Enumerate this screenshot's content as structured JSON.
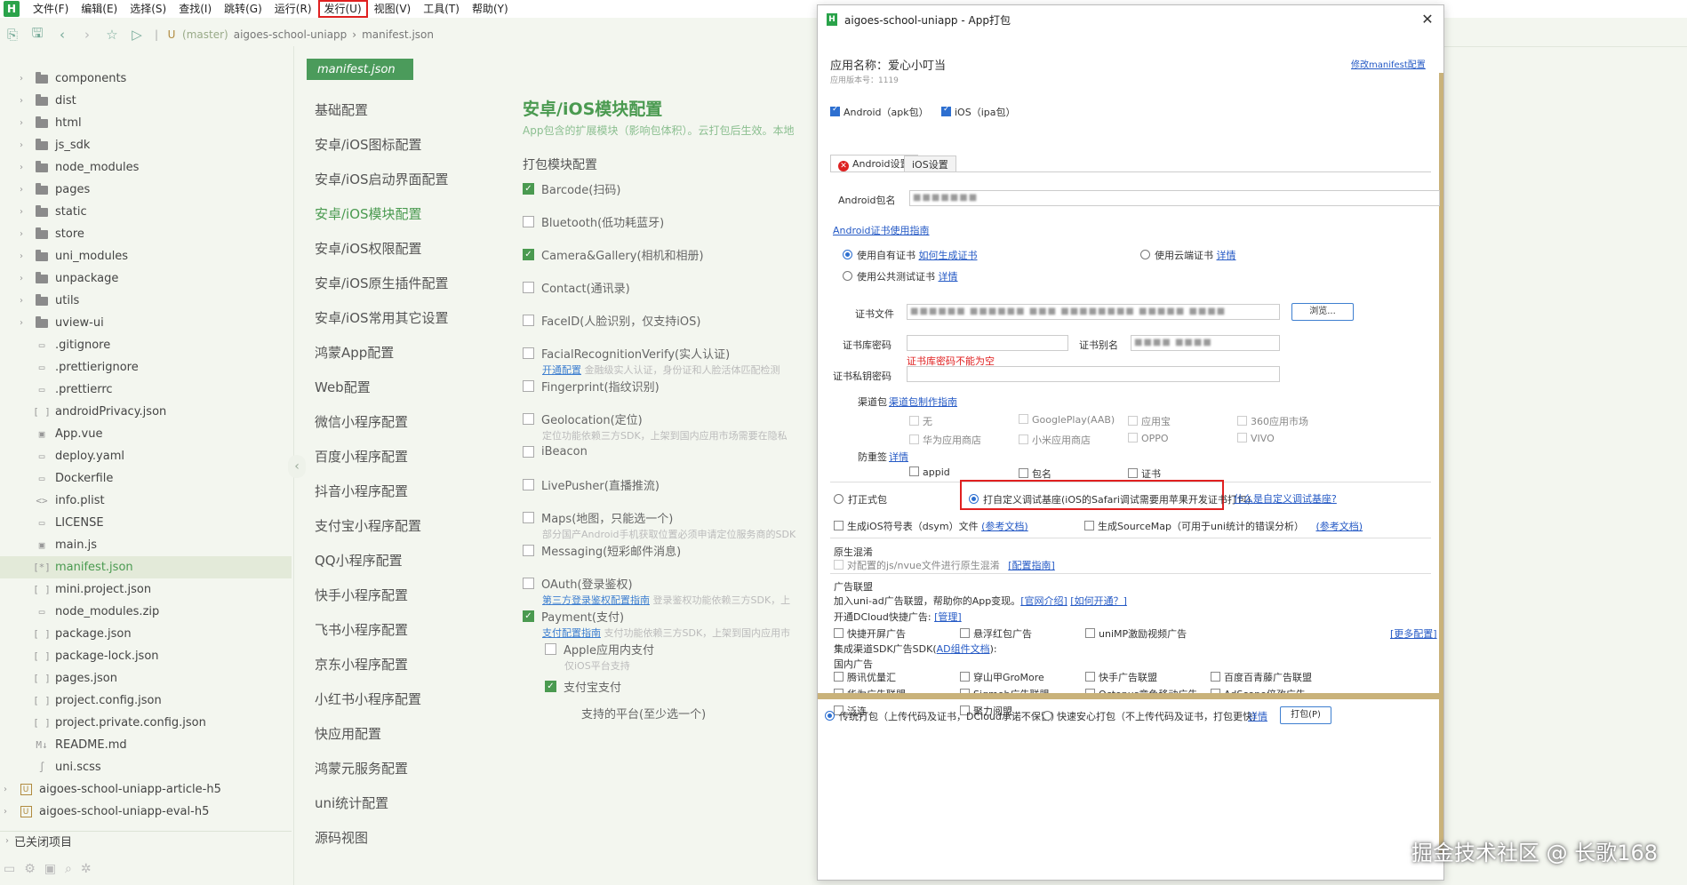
{
  "menubar": {
    "logo": "H",
    "items": [
      "文件(F)",
      "编辑(E)",
      "选择(S)",
      "查找(I)",
      "跳转(G)",
      "运行(R)",
      "发行(U)",
      "视图(V)",
      "工具(T)",
      "帮助(Y)"
    ],
    "highlighted_index": 6
  },
  "toolbar": {
    "branch": "(master)",
    "project": "aigoes-school-uniapp",
    "file": "manifest.json"
  },
  "filetree": {
    "items": [
      {
        "label": "components",
        "type": "folder"
      },
      {
        "label": "dist",
        "type": "folder"
      },
      {
        "label": "html",
        "type": "folder"
      },
      {
        "label": "js_sdk",
        "type": "folder"
      },
      {
        "label": "node_modules",
        "type": "folder"
      },
      {
        "label": "pages",
        "type": "folder"
      },
      {
        "label": "static",
        "type": "folder"
      },
      {
        "label": "store",
        "type": "folder"
      },
      {
        "label": "uni_modules",
        "type": "folder"
      },
      {
        "label": "unpackage",
        "type": "folder"
      },
      {
        "label": "utils",
        "type": "folder"
      },
      {
        "label": "uview-ui",
        "type": "folder"
      },
      {
        "label": ".gitignore",
        "type": "file",
        "glyph": "▭"
      },
      {
        "label": ".prettierignore",
        "type": "file",
        "glyph": "▭"
      },
      {
        "label": ".prettierrc",
        "type": "file",
        "glyph": "▭"
      },
      {
        "label": "androidPrivacy.json",
        "type": "file",
        "glyph": "[ ]"
      },
      {
        "label": "App.vue",
        "type": "file",
        "glyph": "▣"
      },
      {
        "label": "deploy.yaml",
        "type": "file",
        "glyph": "▭"
      },
      {
        "label": "Dockerfile",
        "type": "file",
        "glyph": "▭"
      },
      {
        "label": "info.plist",
        "type": "file",
        "glyph": "<>"
      },
      {
        "label": "LICENSE",
        "type": "file",
        "glyph": "▭"
      },
      {
        "label": "main.js",
        "type": "file",
        "glyph": "▣"
      },
      {
        "label": "manifest.json",
        "type": "file",
        "glyph": "[*]",
        "selected": true
      },
      {
        "label": "mini.project.json",
        "type": "file",
        "glyph": "[ ]"
      },
      {
        "label": "node_modules.zip",
        "type": "file",
        "glyph": "▭"
      },
      {
        "label": "package.json",
        "type": "file",
        "glyph": "[ ]"
      },
      {
        "label": "package-lock.json",
        "type": "file",
        "glyph": "[ ]"
      },
      {
        "label": "pages.json",
        "type": "file",
        "glyph": "[ ]"
      },
      {
        "label": "project.config.json",
        "type": "file",
        "glyph": "[ ]"
      },
      {
        "label": "project.private.config.json",
        "type": "file",
        "glyph": "[ ]"
      },
      {
        "label": "README.md",
        "type": "file",
        "glyph": "M↓"
      },
      {
        "label": "uni.scss",
        "type": "file",
        "glyph": "∫"
      },
      {
        "label": "aigoes-school-uniapp-article-h5",
        "type": "root"
      },
      {
        "label": "aigoes-school-uniapp-eval-h5",
        "type": "root"
      }
    ],
    "closed_projects": "已关闭项目"
  },
  "editor": {
    "tab": "manifest.json",
    "nav": [
      "基础配置",
      "安卓/iOS图标配置",
      "安卓/iOS启动界面配置",
      "安卓/iOS模块配置",
      "安卓/iOS权限配置",
      "安卓/iOS原生插件配置",
      "安卓/iOS常用其它设置",
      "鸿蒙App配置",
      "Web配置",
      "微信小程序配置",
      "百度小程序配置",
      "抖音小程序配置",
      "支付宝小程序配置",
      "QQ小程序配置",
      "快手小程序配置",
      "飞书小程序配置",
      "京东小程序配置",
      "小红书小程序配置",
      "快应用配置",
      "鸿蒙元服务配置",
      "uni统计配置",
      "源码视图"
    ],
    "nav_active_index": 3,
    "module_title": "安卓/iOS模块配置",
    "module_subtitle": "App包含的扩展模块（影响包体积）。云打包后生效。本地",
    "section_title": "打包模块配置",
    "modules": [
      {
        "label": "Barcode(扫码)",
        "checked": true,
        "desc": ""
      },
      {
        "label": "Bluetooth(低功耗蓝牙)",
        "checked": false,
        "desc": ""
      },
      {
        "label": "Camera&Gallery(相机和相册)",
        "checked": true,
        "desc": ""
      },
      {
        "label": "Contact(通讯录)",
        "checked": false,
        "desc": ""
      },
      {
        "label": "FaceID(人脸识别，仅支持iOS)",
        "checked": false,
        "desc": ""
      },
      {
        "label": "FacialRecognitionVerify(实人认证)",
        "checked": false,
        "desc": "金融级实人认证，身份证和人脸活体匹配检测",
        "link": "开通配置"
      },
      {
        "label": "Fingerprint(指纹识别)",
        "checked": false,
        "desc": ""
      },
      {
        "label": "Geolocation(定位)",
        "checked": false,
        "desc": "定位功能依赖三方SDK，上架到国内应用市场需要在隐私"
      },
      {
        "label": "iBeacon",
        "checked": false,
        "desc": ""
      },
      {
        "label": "LivePusher(直播推流)",
        "checked": false,
        "desc": ""
      },
      {
        "label": "Maps(地图，只能选一个)",
        "checked": false,
        "desc": "部分国产Android手机获取位置必须申请定位服务商的SDK"
      },
      {
        "label": "Messaging(短彩邮件消息)",
        "checked": false,
        "desc": ""
      },
      {
        "label": "OAuth(登录鉴权)",
        "checked": false,
        "desc": "登录鉴权功能依赖三方SDK，上",
        "link": "第三方登录鉴权配置指南"
      },
      {
        "label": "Payment(支付)",
        "checked": true,
        "desc": "支付功能依赖三方SDK，上架到国内应用市",
        "link": "支付配置指南"
      }
    ],
    "sub_modules": [
      {
        "label": "Apple应用内支付",
        "checked": false,
        "desc": "仅iOS平台支持"
      },
      {
        "label": "支付宝支付",
        "checked": true,
        "desc": ""
      }
    ],
    "platforms_label": "支持的平台(至少选一个)"
  },
  "dialog": {
    "title": "aigoes-school-uniapp - App打包",
    "app_name_label": "应用名称：爱心小叮当",
    "app_version_label": "应用版本号：1119",
    "modify_manifest_link": "修改manifest配置",
    "targets": [
      {
        "label": "Android（apk包）",
        "checked": true
      },
      {
        "label": "iOS（ipa包）",
        "checked": true
      }
    ],
    "tabs": [
      "Android设置",
      "iOS设置"
    ],
    "package_name_label": "Android包名",
    "package_name_value": "■■■■■■■",
    "cert_guide_link": "Android证书使用指南",
    "cert_options": [
      {
        "label": "使用自有证书",
        "link": "如何生成证书",
        "checked": true
      },
      {
        "label": "使用云端证书",
        "link": "详情",
        "checked": false
      },
      {
        "label": "使用公共测试证书",
        "link": "详情",
        "checked": false
      }
    ],
    "cert_file_label": "证书文件",
    "cert_file_value": "■■■■■■ ■■■■■■ ■■■ ■■■■■■■■ ■■■■■ ■■■■",
    "browse_button": "浏览...",
    "keystore_password_label": "证书库密码",
    "keystore_password_value": "",
    "keystore_error": "证书库密码不能为空",
    "alias_label": "证书别名",
    "alias_value": "■■■■ ■■■■",
    "private_key_label": "证书私钥密码",
    "private_key_value": "",
    "channel_label": "渠道包",
    "channel_link": "渠道包制作指南",
    "channels": [
      "无",
      "GooglePlay(AAB)",
      "应用宝",
      "360应用市场",
      "华为应用商店",
      "小米应用商店",
      "OPPO",
      "VIVO"
    ],
    "anti_tamper_label": "防重签",
    "anti_tamper_link": "详情",
    "anti_tamper_options": [
      "appid",
      "包名",
      "证书"
    ],
    "build_mode_options": [
      {
        "label": "打正式包",
        "checked": false
      },
      {
        "label": "打自定义调试基座(iOS的Safari调试需要用苹果开发证书打包)",
        "checked": true
      }
    ],
    "custom_base_link": "什么是自定义调试基座?",
    "dsym_label": "生成iOS符号表（dsym）文件",
    "dsym_link": "(参考文档)",
    "sourcemap_label": "生成SourceMap（可用于uni统计的错误分析）",
    "sourcemap_link": "(参考文档)",
    "native_obf_title": "原生混淆",
    "native_obf_label": "对配置的js/nvue文件进行原生混淆",
    "native_obf_link": "[配置指南]",
    "ad_title": "广告联盟",
    "ad_join_label": "加入uni-ad广告联盟，帮助你的App变现。",
    "ad_intro_link": "[官网介绍]",
    "ad_open_link": "[如何开通？]",
    "ad_dcloud_label": "开通DCloud快捷广告:",
    "ad_manage_link": "[管理]",
    "ad_quick_options": [
      "快捷开屏广告",
      "悬浮红包广告",
      "uniMP激励视频广告"
    ],
    "ad_more_link": "[更多配置]",
    "ad_sdk_label": "集成渠道SDK广告SDK(",
    "ad_sdk_link": "AD组件文档",
    "ad_sdk_suffix": "):",
    "ad_domestic_label": "国内广告",
    "ad_channels": [
      "腾讯优量汇",
      "穿山甲GroMore",
      "快手广告联盟",
      "百度百青藤广告联盟",
      "华为广告联盟",
      "Sigmob广告联盟",
      "Octopus章鱼移动广告",
      "AdScope倍孜广告",
      "泛连",
      "聚力阅盟"
    ],
    "pack_mode_options": [
      {
        "label": "传统打包（上传代码及证书，DCloud承诺不保留）",
        "checked": true
      },
      {
        "label": "快速安心打包（不上传代码及证书，打包更快）",
        "checked": false
      }
    ],
    "pack_detail_link": "详情",
    "pack_button": "打包(P)"
  },
  "watermark": "掘金技术社区 @ 长歌168"
}
